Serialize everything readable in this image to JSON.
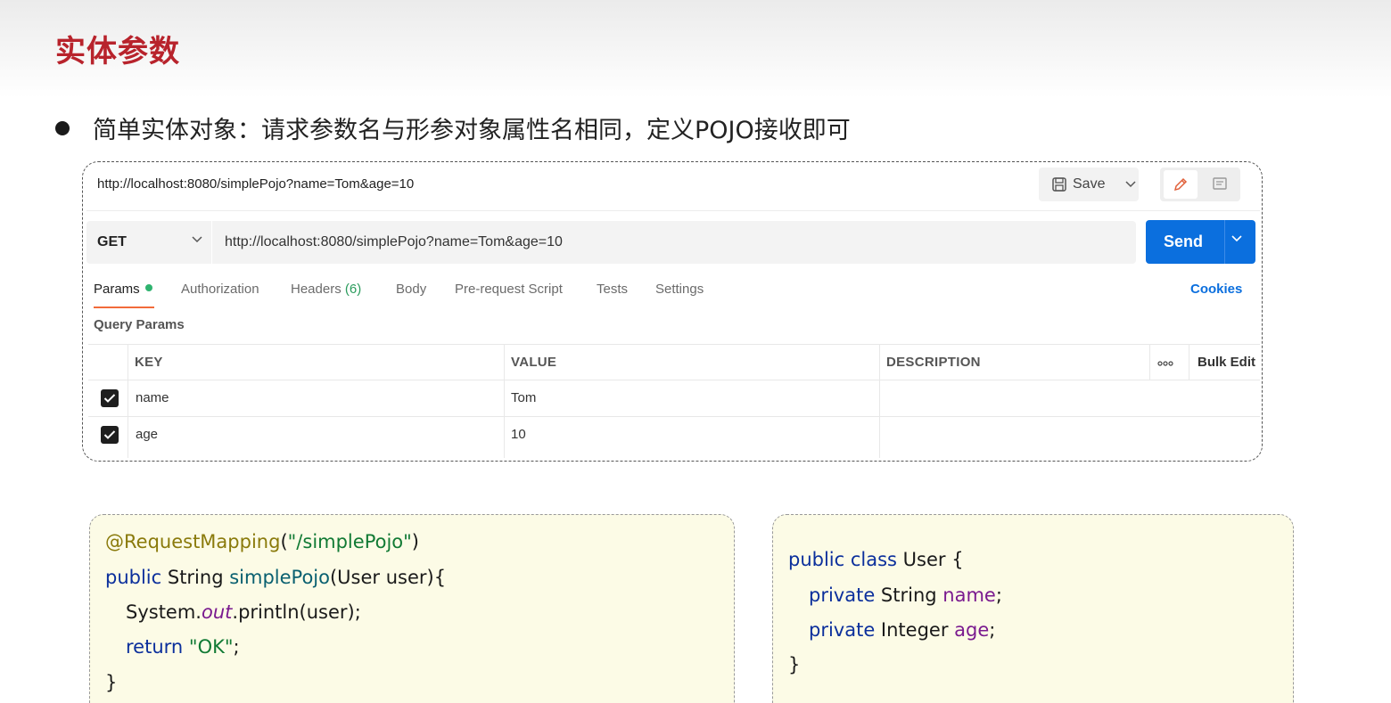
{
  "slide": {
    "title": "实体参数",
    "bullet": "简单实体对象：请求参数名与形参对象属性名相同，定义POJO接收即可"
  },
  "postman": {
    "title_url": "http://localhost:8080/simplePojo?name=Tom&age=10",
    "save_label": "Save",
    "method": "GET",
    "url": "http://localhost:8080/simplePojo?name=Tom&age=10",
    "send_label": "Send",
    "tabs": {
      "params": "Params",
      "authorization": "Authorization",
      "headers": "Headers",
      "headers_count": "(6)",
      "body": "Body",
      "prerequest": "Pre-request Script",
      "tests": "Tests",
      "settings": "Settings"
    },
    "cookies": "Cookies",
    "query_params_label": "Query Params",
    "table": {
      "col_key": "KEY",
      "col_value": "VALUE",
      "col_description": "DESCRIPTION",
      "bulk_edit": "Bulk Edit",
      "rows": [
        {
          "key": "name",
          "value": "Tom",
          "description": "",
          "checked": true
        },
        {
          "key": "age",
          "value": "10",
          "description": "",
          "checked": true
        }
      ]
    },
    "colors": {
      "send": "#0b6fde",
      "active_tab": "#f26b3a",
      "cookies": "#0b6fde"
    }
  },
  "code_left": {
    "l1_annotation": "@RequestMapping",
    "l1_open": "(",
    "l1_string": "\"/simplePojo\"",
    "l1_close": ")",
    "l2_kw": "public",
    "l2_type": " String ",
    "l2_method": "simplePojo",
    "l2_params": "(User user){",
    "l3_system": "System.",
    "l3_field": "out",
    "l3_call": ".println(user);",
    "l4_kw": "return",
    "l4_space": " ",
    "l4_string": "\"OK\"",
    "l4_semi": ";",
    "l5": "}"
  },
  "code_right": {
    "l1_kw": "public class",
    "l1_rest": " User {",
    "l2_kw": "private",
    "l2_type": " String ",
    "l2_field": "name",
    "l2_semi": ";",
    "l3_kw": "private",
    "l3_type": " Integer ",
    "l3_field": "age",
    "l3_semi": ";",
    "l4": "}"
  }
}
